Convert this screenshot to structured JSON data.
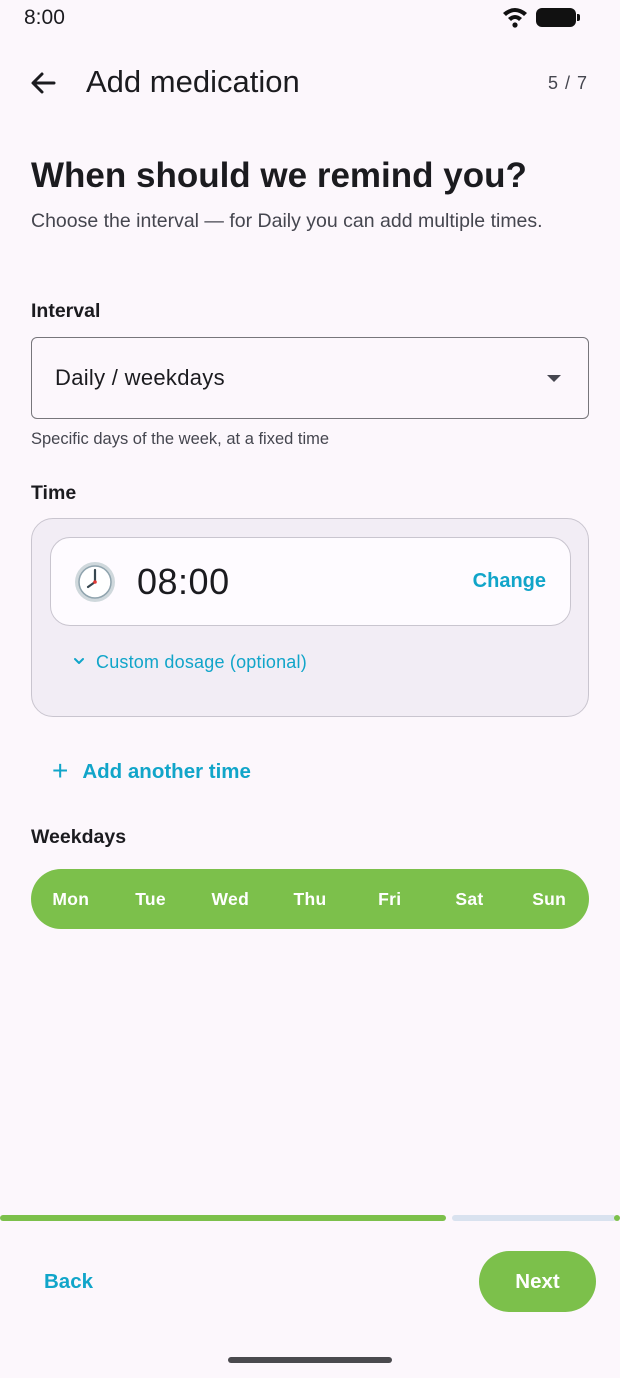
{
  "status_bar": {
    "time": "8:00",
    "icons": [
      "wifi-icon",
      "battery-icon"
    ]
  },
  "app_bar": {
    "title": "Add medication",
    "step": "5 / 7",
    "back_icon": "arrow-back-icon"
  },
  "header": {
    "title": "When should we remind you?",
    "subtitle": "Choose the interval — for Daily you can add multiple times."
  },
  "interval": {
    "label": "Interval",
    "value": "Daily / weekdays",
    "helper": "Specific days of the week, at a fixed time"
  },
  "time_section": {
    "label": "Time",
    "entries": [
      {
        "time": "08:00",
        "change_label": "Change",
        "icon": "clock-icon"
      }
    ],
    "custom_dosage_label": "Custom dosage (optional)",
    "add_time_label": "Add another time"
  },
  "weekdays": {
    "label": "Weekdays",
    "days": [
      "Mon",
      "Tue",
      "Wed",
      "Thu",
      "Fri",
      "Sat",
      "Sun"
    ],
    "selected": [
      "Mon",
      "Tue",
      "Wed",
      "Thu",
      "Fri",
      "Sat",
      "Sun"
    ]
  },
  "progress": {
    "current_step": 5,
    "total_steps": 7,
    "fraction": 0.72
  },
  "footer": {
    "back_label": "Back",
    "next_label": "Next"
  },
  "colors": {
    "accent": "#7cc04b",
    "link": "#11a5c9",
    "background": "#fcf7fc"
  }
}
